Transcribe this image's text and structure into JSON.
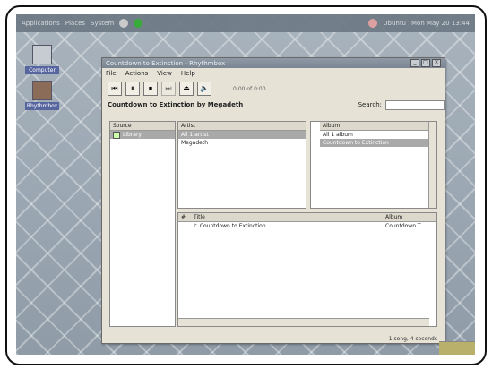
{
  "panel": {
    "left_items": [
      "Applications",
      "Places",
      "System"
    ],
    "right_items": [
      "Ubuntu",
      "Mon May 20 13:44"
    ]
  },
  "desktop": {
    "icons": [
      {
        "label": "Computer"
      },
      {
        "label": "Rhythmbox"
      }
    ]
  },
  "window": {
    "title": "Countdown to Extinction - Rhythmbox",
    "menus": [
      "File",
      "Actions",
      "View",
      "Help"
    ],
    "counter": "0:00 of 0:00",
    "now_playing": "Countdown to Extinction by Megadeth",
    "search_label": "Search:",
    "search_value": "",
    "source_header": "Source",
    "sources": [
      "Library"
    ],
    "artist_header": "Artist",
    "artists": [
      "All 1 artist",
      "Megadeth"
    ],
    "album_header": "Album",
    "albums": [
      "All 1 album",
      "Countdown to Extinction"
    ],
    "tracks_cols": [
      "#",
      "Title",
      "Album"
    ],
    "tracks": [
      {
        "num": "",
        "title": "Countdown to Extinction",
        "album": "Countdown T"
      }
    ],
    "status": "1 song, 4 seconds"
  }
}
